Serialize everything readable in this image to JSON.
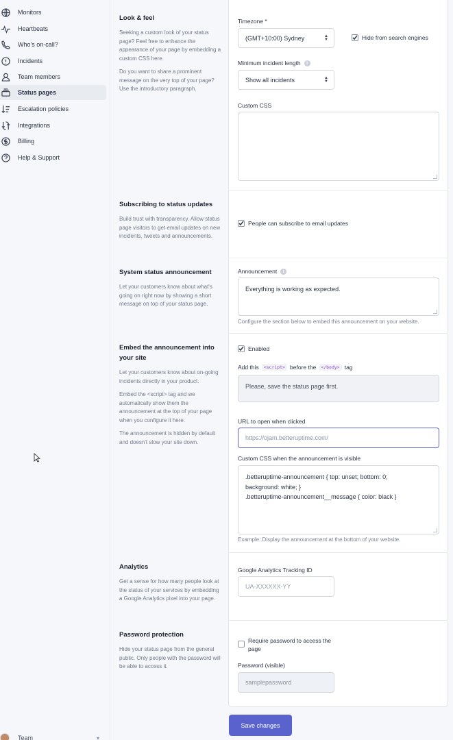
{
  "sidebar": {
    "items": [
      {
        "label": "Monitors",
        "icon": "globe-icon"
      },
      {
        "label": "Heartbeats",
        "icon": "heartbeat-icon"
      },
      {
        "label": "Who's on-call?",
        "icon": "phone-icon"
      },
      {
        "label": "Incidents",
        "icon": "alert-circle-icon"
      },
      {
        "label": "Team members",
        "icon": "user-icon"
      },
      {
        "label": "Status pages",
        "icon": "layers-icon",
        "active": true
      },
      {
        "label": "Escalation policies",
        "icon": "escalation-icon"
      },
      {
        "label": "Integrations",
        "icon": "integrations-icon"
      },
      {
        "label": "Billing",
        "icon": "dollar-icon"
      },
      {
        "label": "Help & Support",
        "icon": "help-icon"
      }
    ],
    "team_label": "Team"
  },
  "sections": {
    "look_feel": {
      "title": "Look & feel",
      "p1": "Seeking a custom look of your status page? Feel free to enhance the appearance of your page by embedding a custom CSS here.",
      "p2": "Do you want to share a prominent message on the very top of your page? Use the introductory paragraph."
    },
    "subscribing": {
      "title": "Subscribing to status updates",
      "p1": "Build trust with transparency. Allow status page visitors to get email updates on new incidents, tweets and announcements."
    },
    "announcement": {
      "title": "System status announcement",
      "p1": "Let your customers know about what's going on right now by showing a short message on top of your status page."
    },
    "embed": {
      "title": "Embed the announcement into your site",
      "p1": "Let your customers know about on-going incidents directly in your product.",
      "p2": "Embed the <script> tag and we automatically show them the announcement at the top of your page when you configure it here.",
      "p3": "The announcement is hidden by default and doesn't slow your site down."
    },
    "analytics": {
      "title": "Analytics",
      "p1": "Get a sense for how many people look at the status of your services by embedding a Google Analytics pixel into your page."
    },
    "password": {
      "title": "Password protection",
      "p1": "Hide your status page from the general public. Only people with the password will be able to access it."
    }
  },
  "form": {
    "timezone_label": "Timezone *",
    "timezone_value": "(GMT+10:00) Sydney",
    "hide_search_label": "Hide from search engines",
    "hide_search_checked": true,
    "min_incident_label": "Minimum incident length",
    "min_incident_value": "Show all incidents",
    "custom_css_label": "Custom CSS",
    "custom_css_value": "",
    "subscribe_label": "People can subscribe to email updates",
    "subscribe_checked": true,
    "announcement_label": "Announcement",
    "announcement_value": "Everything is working as expected.",
    "announcement_hint": "Configure the section below to embed this announcement on your website.",
    "enabled_label": "Enabled",
    "enabled_checked": true,
    "embed_prefix": "Add this",
    "embed_code_script": "<script>",
    "embed_middle": "before the",
    "embed_code_body": "</body>",
    "embed_suffix": "tag",
    "embed_snippet": "Please, save the status page first.",
    "url_label": "URL to open when clicked",
    "url_placeholder": "https://ojam.betteruptime.com/",
    "css_visible_label": "Custom CSS when the announcement is visible",
    "css_visible_line1": ".betteruptime-announcement { top: unset; bottom: 0;",
    "css_visible_line2": "background: white; }",
    "css_visible_line3": ".betteruptime-announcement__message { color: black }",
    "css_visible_hint": "Example: Display the announcement at the bottom of your website.",
    "ga_label": "Google Analytics Tracking ID",
    "ga_placeholder": "UA-XXXXXX-YY",
    "require_password_label": "Require password to access the page",
    "require_password_checked": false,
    "password_label": "Password (visible)",
    "password_placeholder": "samplepassword",
    "save_label": "Save changes"
  },
  "colors": {
    "accent": "#5a62cd",
    "focus_border": "#5b63d3",
    "sidebar_bg": "#f5f7fa",
    "code_text": "#8b4fc0"
  }
}
